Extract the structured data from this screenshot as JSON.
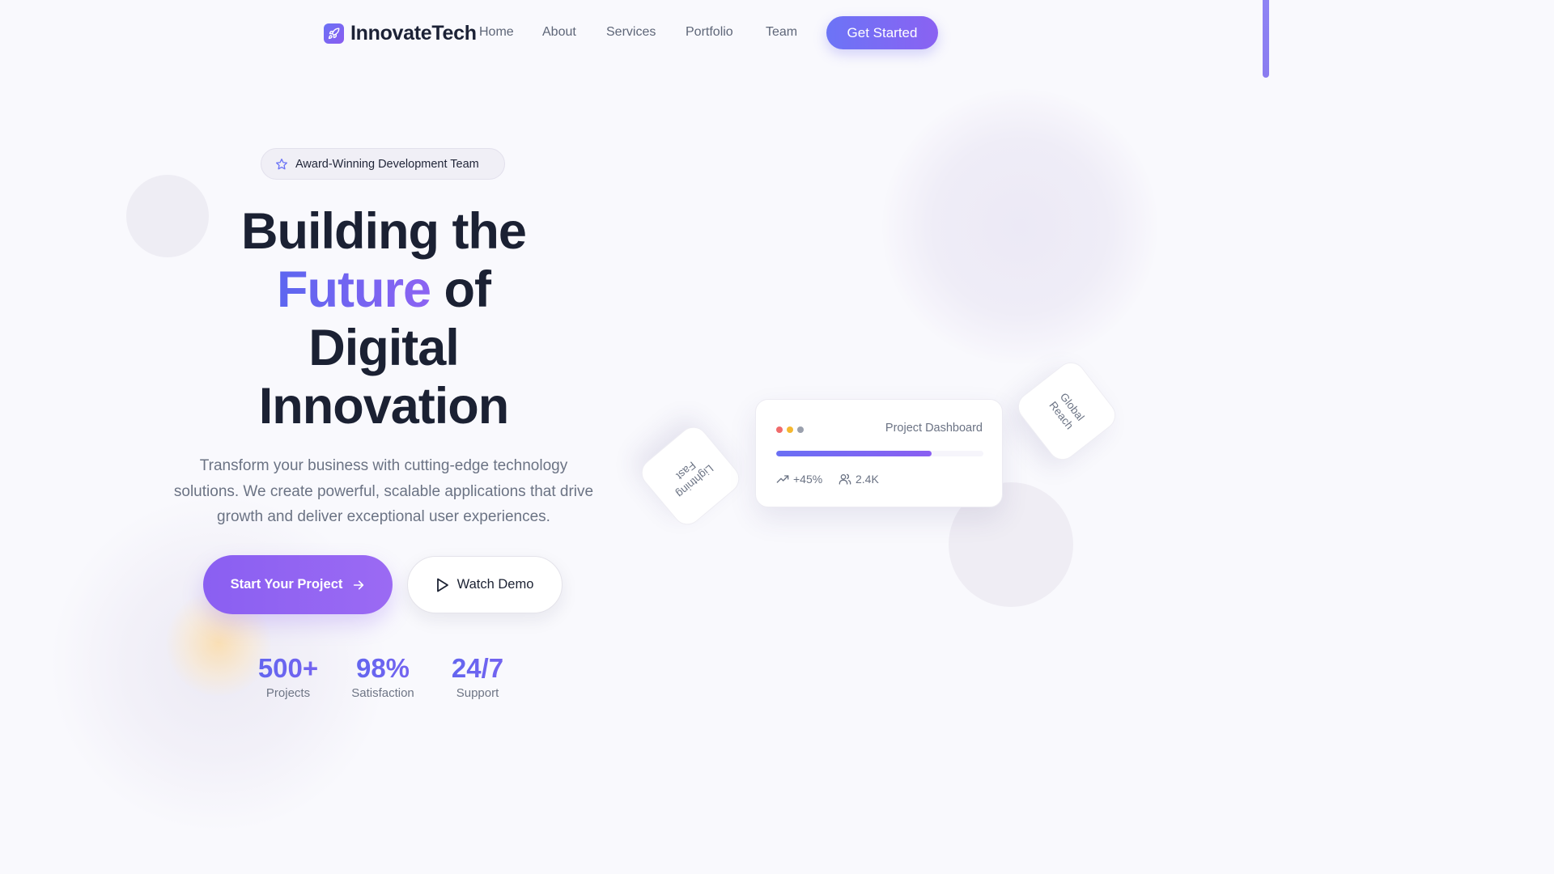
{
  "brand": {
    "name": "InnovateTech",
    "logo_icon": "rocket-icon"
  },
  "nav": {
    "links": [
      "Home",
      "About",
      "Services",
      "Portfolio",
      "Team"
    ],
    "cta_label": "Get Started"
  },
  "hero": {
    "badge": {
      "icon": "star-icon",
      "text": "Award-Winning Development Team"
    },
    "headline": {
      "line1": "Building the",
      "accent": "Future",
      "line2_rest": " of",
      "line3": "Digital",
      "line4": "Innovation"
    },
    "subtext": "Transform your business with cutting-edge technology solutions. We create powerful, scalable applications that drive growth and deliver exceptional user experiences.",
    "primary_button": {
      "label": "Start Your Project",
      "icon": "arrow-right-icon"
    },
    "secondary_button": {
      "label": "Watch Demo",
      "icon": "play-icon"
    },
    "stats": [
      {
        "value": "500+",
        "label": "Projects"
      },
      {
        "value": "98%",
        "label": "Satisfaction"
      },
      {
        "value": "24/7",
        "label": "Support"
      }
    ]
  },
  "dashboard_card": {
    "title": "Project Dashboard",
    "window_dots": [
      "#f06b6b",
      "#f5b830",
      "#9aa0ad"
    ],
    "progress_fraction": 0.75,
    "growth": {
      "icon": "trending-up-icon",
      "value": "+45%"
    },
    "users": {
      "icon": "users-icon",
      "value": "2.4K"
    }
  },
  "floating_chips": {
    "lightning": {
      "line1": "Lightning",
      "line2": "Fast"
    },
    "global": {
      "line1": "Global",
      "line2": "Reach"
    }
  },
  "colors": {
    "accent_blue": "#6c74f6",
    "accent_purple": "#8a5ff2",
    "heading": "#1b2133",
    "body_text": "#6b7384",
    "background": "#f9f9fd"
  }
}
